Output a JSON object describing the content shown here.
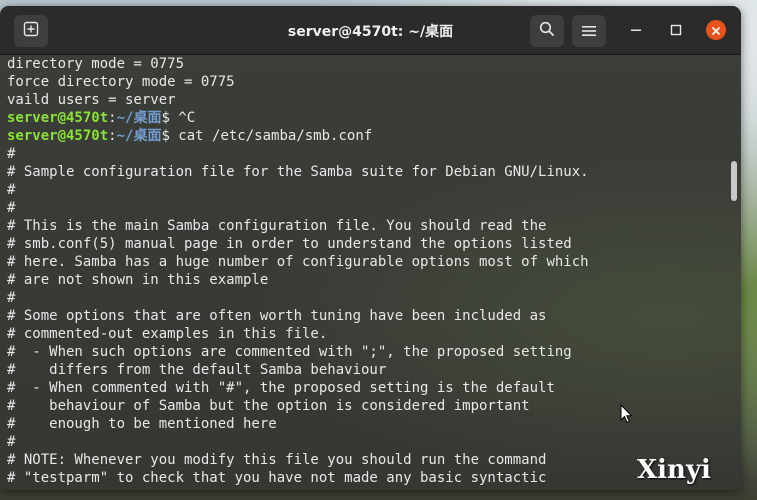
{
  "window": {
    "title": "server@4570t: ~/桌面"
  },
  "terminal": {
    "lines": [
      {
        "prompt": false,
        "text": "directory mode = 0775"
      },
      {
        "prompt": false,
        "text": "force directory mode = 0775"
      },
      {
        "prompt": false,
        "text": "vaild users = server"
      },
      {
        "prompt": true,
        "user": "server@4570t",
        "sep": ":",
        "path": "~/桌面",
        "cmd": "$ ^C"
      },
      {
        "prompt": true,
        "user": "server@4570t",
        "sep": ":",
        "path": "~/桌面",
        "cmd": "$ cat /etc/samba/smb.conf"
      },
      {
        "prompt": false,
        "text": "#"
      },
      {
        "prompt": false,
        "text": "# Sample configuration file for the Samba suite for Debian GNU/Linux."
      },
      {
        "prompt": false,
        "text": "#"
      },
      {
        "prompt": false,
        "text": "#"
      },
      {
        "prompt": false,
        "text": "# This is the main Samba configuration file. You should read the"
      },
      {
        "prompt": false,
        "text": "# smb.conf(5) manual page in order to understand the options listed"
      },
      {
        "prompt": false,
        "text": "# here. Samba has a huge number of configurable options most of which"
      },
      {
        "prompt": false,
        "text": "# are not shown in this example"
      },
      {
        "prompt": false,
        "text": "#"
      },
      {
        "prompt": false,
        "text": "# Some options that are often worth tuning have been included as"
      },
      {
        "prompt": false,
        "text": "# commented-out examples in this file."
      },
      {
        "prompt": false,
        "text": "#  - When such options are commented with \";\", the proposed setting"
      },
      {
        "prompt": false,
        "text": "#    differs from the default Samba behaviour"
      },
      {
        "prompt": false,
        "text": "#  - When commented with \"#\", the proposed setting is the default"
      },
      {
        "prompt": false,
        "text": "#    behaviour of Samba but the option is considered important"
      },
      {
        "prompt": false,
        "text": "#    enough to be mentioned here"
      },
      {
        "prompt": false,
        "text": "#"
      },
      {
        "prompt": false,
        "text": "# NOTE: Whenever you modify this file you should run the command"
      },
      {
        "prompt": false,
        "text": "# \"testparm\" to check that you have not made any basic syntactic"
      }
    ]
  },
  "watermark": "Xinyi",
  "icons": {
    "new_tab": "new-tab-icon",
    "search": "search-icon",
    "menu": "hamburger-menu-icon",
    "minimize": "minimize-icon",
    "maximize": "maximize-icon",
    "close": "close-icon",
    "pointer": "mouse-pointer-icon"
  },
  "colors": {
    "prompt_user": "#8ae234",
    "prompt_path": "#729fcf",
    "close_button": "#e9541e"
  }
}
